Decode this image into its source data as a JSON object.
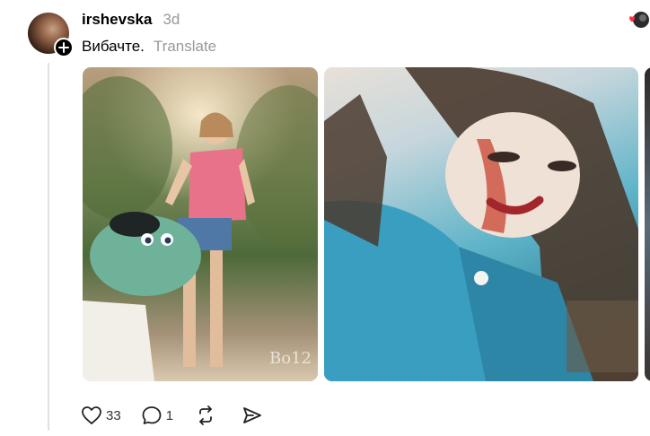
{
  "post": {
    "username": "irshevska",
    "timestamp": "3d",
    "caption": "Вибачте.",
    "translate_label": "Translate",
    "media_count": 3
  },
  "actions": {
    "likes": "33",
    "replies": "1"
  },
  "icons": {
    "follow": "plus-icon",
    "like": "heart-icon",
    "reply": "comment-icon",
    "repost": "repost-icon",
    "share": "send-icon",
    "top_right": "liked-by-avatar-icon"
  },
  "colors": {
    "accent": "#000000",
    "muted": "#999999",
    "heart_red": "#ff3040"
  }
}
